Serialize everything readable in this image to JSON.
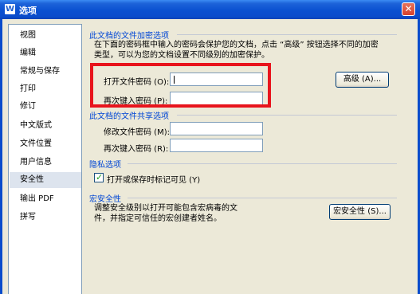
{
  "window": {
    "title": "选项",
    "app_icon": "W",
    "close_glyph": "✕"
  },
  "sidebar": {
    "items": [
      {
        "label": "视图"
      },
      {
        "label": "编辑"
      },
      {
        "label": "常规与保存"
      },
      {
        "label": "打印"
      },
      {
        "label": "修订"
      },
      {
        "label": "中文版式"
      },
      {
        "label": "文件位置"
      },
      {
        "label": "用户信息"
      },
      {
        "label": "安全性",
        "selected": true
      },
      {
        "label": "输出 PDF"
      },
      {
        "label": "拼写"
      }
    ]
  },
  "encryption": {
    "title": "此文档的文件加密选项",
    "desc_line1": "在下面的密码框中输入的密码会保护您的文档，点击 “高级” 按钮选择不同的加密",
    "desc_line2": "类型，可以为您的文档设置不同级别的加密保护。",
    "open_password_label": "打开文件密码 (O):",
    "open_password_value": "",
    "reenter_label": "再次键入密码 (P):",
    "reenter_value": "",
    "advanced_button": "高级 (A)..."
  },
  "sharing": {
    "title": "此文档的文件共享选项",
    "modify_password_label": "修改文件密码 (M):",
    "modify_password_value": "",
    "reenter_label": "再次键入密码 (R):",
    "reenter_value": ""
  },
  "privacy": {
    "title": "隐私选项",
    "checkbox_label": "打开或保存时标记可见 (Y)",
    "checked": true
  },
  "macro": {
    "title": "宏安全性",
    "desc_line1": "调整安全级别以打开可能包含宏病毒的文",
    "desc_line2": "件，并指定可信任的宏创建者姓名。",
    "button": "宏安全性 (S)..."
  },
  "colors": {
    "highlight": "#e8141c",
    "section_title": "#0046d5",
    "titlebar": "#0a50d0"
  }
}
